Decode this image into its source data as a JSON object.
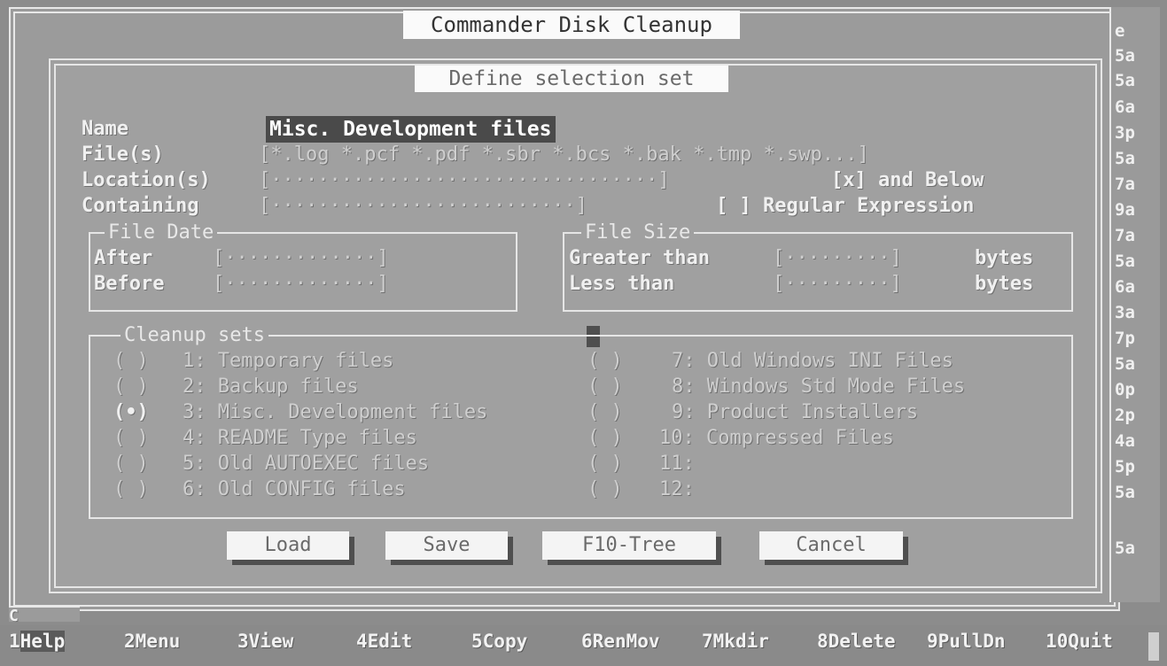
{
  "window": {
    "title": "Commander Disk Cleanup"
  },
  "dialog": {
    "title": "Define selection set"
  },
  "fields": {
    "name_label": "Name",
    "name_value": "Misc. Development files",
    "files_label": "File(s)",
    "files_value": "*.log *.pcf *.pdf *.sbr *.bcs *.bak *.tmp *.swp",
    "locations_label": "Location(s)",
    "and_below_label": "[x] and Below",
    "containing_label": "Containing",
    "regex_label": "[ ] Regular Expression"
  },
  "file_date": {
    "title": "File Date",
    "after_label": "After",
    "before_label": "Before"
  },
  "file_size": {
    "title": "File Size",
    "greater_label": "Greater than",
    "less_label": "Less than",
    "unit": "bytes"
  },
  "cleanup_sets": {
    "title": "Cleanup sets",
    "items": [
      {
        "radio": "( )",
        "label": "1: Temporary files"
      },
      {
        "radio": "( )",
        "label": "2: Backup files"
      },
      {
        "radio": "(•)",
        "label": "3: Misc. Development files"
      },
      {
        "radio": "( )",
        "label": "4: README Type files"
      },
      {
        "radio": "( )",
        "label": "5: Old AUTOEXEC files"
      },
      {
        "radio": "( )",
        "label": "6: Old CONFIG files"
      },
      {
        "radio": "( )",
        "label": "7: Old Windows INI Files"
      },
      {
        "radio": "( )",
        "label": "8: Windows Std Mode Files"
      },
      {
        "radio": "( )",
        "label": "9: Product Installers"
      },
      {
        "radio": "( )",
        "label": "10: Compressed Files"
      },
      {
        "radio": "( )",
        "label": "11:"
      },
      {
        "radio": "( )",
        "label": "12:"
      }
    ]
  },
  "buttons": {
    "load": "Load",
    "save": "Save",
    "tree": "F10-Tree",
    "cancel": "Cancel"
  },
  "right_strip": [
    "e",
    "5a",
    "5a",
    "6a",
    "3p",
    "5a",
    "7a",
    "9a",
    "7a",
    "5a",
    "6a",
    "3a",
    "7p",
    "5a",
    "0p",
    "2p",
    "4a",
    "5p",
    "5a",
    "5a"
  ],
  "left_corner": "C",
  "function_keys": [
    {
      "num": "1",
      "label": "Help"
    },
    {
      "num": "2",
      "label": "Menu"
    },
    {
      "num": "3",
      "label": "View"
    },
    {
      "num": "4",
      "label": "Edit"
    },
    {
      "num": "5",
      "label": "Copy"
    },
    {
      "num": "6",
      "label": "RenMov"
    },
    {
      "num": "7",
      "label": "Mkdir"
    },
    {
      "num": "8",
      "label": "Delete"
    },
    {
      "num": "9",
      "label": "PullDn"
    },
    {
      "num": "10",
      "label": "Quit"
    }
  ]
}
